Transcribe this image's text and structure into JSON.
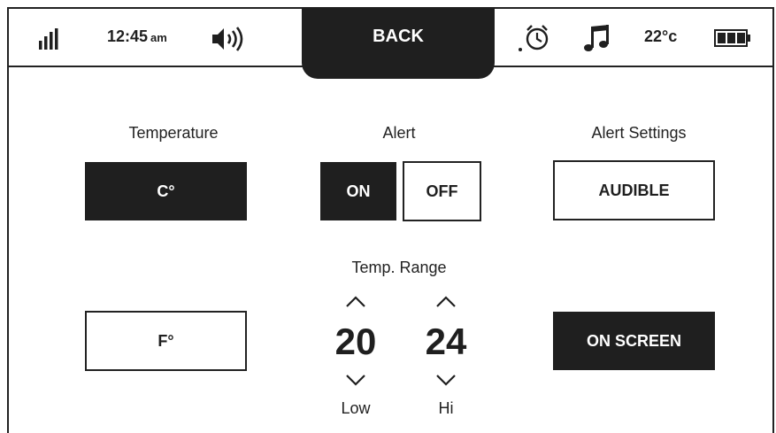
{
  "status": {
    "time": "12:45",
    "ampm": "am",
    "temperature": "22°c",
    "back_label": "BACK"
  },
  "icons": [
    "signal-icon",
    "speaker-icon",
    "alarm-icon",
    "music-icon",
    "battery-icon"
  ],
  "temperature": {
    "label": "Temperature",
    "celsius_label": "C°",
    "fahrenheit_label": "F°",
    "selected": "C°"
  },
  "alert": {
    "label": "Alert",
    "on_label": "ON",
    "off_label": "OFF",
    "selected": "ON"
  },
  "alert_settings": {
    "label": "Alert Settings",
    "audible_label": "AUDIBLE",
    "on_screen_label": "ON SCREEN",
    "selected": "ON SCREEN"
  },
  "temp_range": {
    "label": "Temp. Range",
    "low_value": "20",
    "high_value": "24",
    "low_label": "Low",
    "high_label": "Hi"
  },
  "colors": {
    "dark": "#1f1f1f",
    "light": "#ffffff"
  }
}
